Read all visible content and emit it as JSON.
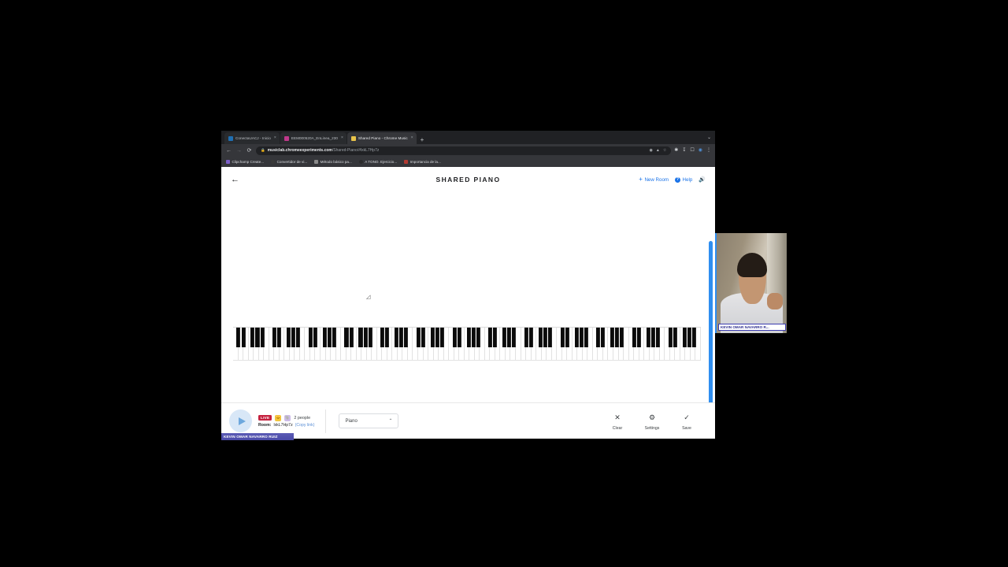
{
  "browser": {
    "tabs": [
      {
        "title": "ConectaUACJ - Inicio",
        "favicon_color": "#1f6fb2",
        "active": false,
        "close_label": "×"
      },
      {
        "title": "EEM000520A_EnLinea_230",
        "favicon_color": "#c0398b",
        "active": false,
        "close_label": "×"
      },
      {
        "title": "Shared Piano - Chrome Music",
        "favicon_color": "#e8c34a",
        "active": true,
        "close_label": "×"
      }
    ],
    "new_tab_label": "+",
    "window_menu_label": "⌄",
    "nav": {
      "back": "←",
      "forward": "→",
      "reload": "⟳"
    },
    "omnibox": {
      "lock_icon": "🔒",
      "url_bold": "musiclab.chromeexperiments.com",
      "url_dim": "/Shared-Piano/#lxkL7Hp7z",
      "inline_actions": [
        "◉",
        "⭐",
        "☆"
      ]
    },
    "toolbar_icons": [
      "📌",
      "⬇",
      "❐",
      "🟢",
      "⋮"
    ],
    "bookmarks": [
      {
        "label": "Clipchamp Create...",
        "favicon_color": "#7b5ec7"
      },
      {
        "label": "Convertidor de vi...",
        "favicon_color": "#3a3a3a"
      },
      {
        "label": "Método básico pa...",
        "favicon_color": "#8a8a8a"
      },
      {
        "label": "A TONO. Ejercicio...",
        "favicon_color": "#2b2b2b"
      },
      {
        "label": "Importancia de la...",
        "favicon_color": "#b23a32"
      }
    ]
  },
  "app": {
    "title": "SHARED PIANO",
    "back_arrow": "←",
    "new_room_label": "New Room",
    "new_room_plus": "+",
    "help_label": "Help",
    "help_glyph": "?",
    "volume_glyph": "🔊",
    "cursor_glyph": "☷"
  },
  "toolbar": {
    "play_label": "Play",
    "live_badge": "LIVE",
    "people_count": "2 people",
    "avatars": [
      {
        "glyph": "🐱",
        "bg": "#f2c53d"
      },
      {
        "glyph": "🐘",
        "bg": "#cdbbe8"
      }
    ],
    "room_label": "Room:",
    "room_code": "lxkL7Hp7z",
    "copy_link_label": "(Copy link)",
    "instrument": "Piano",
    "instrument_chevron": "⌃",
    "actions": [
      {
        "name": "clear",
        "glyph": "✕",
        "label": "Clear"
      },
      {
        "name": "settings",
        "glyph": "⚙",
        "label": "Settings"
      },
      {
        "name": "save",
        "glyph": "✓",
        "label": "Save"
      }
    ]
  },
  "participants": {
    "local_name_tag": "KEVIN OMAR NAVARRO RUIZ",
    "webcam_name_tag": "KEVIN OMAR NAVARRO R..."
  },
  "keyboard": {
    "octave_count": 13,
    "white_keys_per_octave": 7,
    "black_key_positions": [
      1,
      2,
      4,
      5,
      6
    ]
  },
  "colors": {
    "accent_blue": "#1a73e8",
    "scroll_indicator": "#2f8ef0",
    "live_red": "#c5223f",
    "play_bg": "#d8e7f7",
    "name_tag_purple": "#5b5bb5"
  }
}
